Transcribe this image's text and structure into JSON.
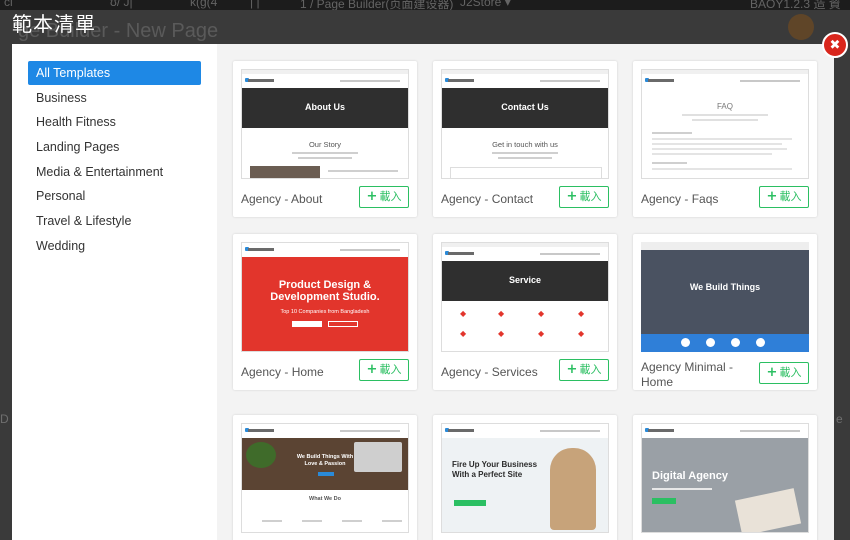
{
  "background": {
    "page_title": "ge Builder - New Page",
    "topbar_items": [
      "cl",
      "ʊ/ J|",
      "k(g(4",
      "| |",
      "1 / Page Builder(页面建设器)",
      "J2Store ▾",
      "BAOY1.2.3 造 資"
    ],
    "left_letter": "D",
    "right_letter": "e"
  },
  "modal": {
    "title": "範本清單",
    "close_icon": "✖",
    "categories": [
      {
        "label": "All Templates",
        "active": true
      },
      {
        "label": "Business"
      },
      {
        "label": "Health Fitness"
      },
      {
        "label": "Landing Pages"
      },
      {
        "label": "Media & Entertainment"
      },
      {
        "label": "Personal"
      },
      {
        "label": "Travel & Lifestyle"
      },
      {
        "label": "Wedding"
      }
    ],
    "load_label": "載入",
    "templates": [
      {
        "name": "Agency - About",
        "hero": "About Us",
        "sub": "Our Story"
      },
      {
        "name": "Agency - Contact",
        "hero": "Contact Us",
        "sub": "Get in touch with us"
      },
      {
        "name": "Agency - Faqs",
        "hero": "FAQ"
      },
      {
        "name": "Agency - Home",
        "hero": "Product Design & Development Studio.",
        "sub": "Top 10 Companies from Bangladesh"
      },
      {
        "name": "Agency - Services",
        "hero": "Service"
      },
      {
        "name": "Agency Minimal - Home",
        "hero": "We Build Things"
      },
      {
        "name": "",
        "hero": "We Build Things With Love & Passion",
        "sub": "What We Do"
      },
      {
        "name": "",
        "hero": "Fire Up Your Business With a Perfect Site"
      },
      {
        "name": "",
        "hero": "Digital Agency"
      }
    ],
    "colors": {
      "accent": "#1e88e5",
      "load_green": "#2bbf62",
      "close_red": "#d9261c"
    }
  }
}
